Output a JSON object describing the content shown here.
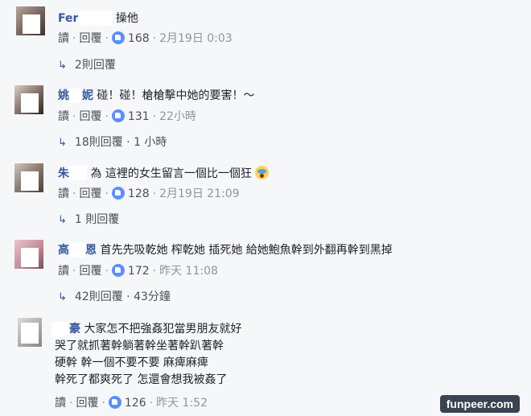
{
  "labels": {
    "read": "讀",
    "reply": "回覆"
  },
  "comments": [
    {
      "name": "Fer",
      "text": "操他",
      "likes": "168",
      "time": "2月19日 0:03",
      "replies": "2則回覆"
    },
    {
      "name": "姚",
      "name2": "妮",
      "text": "碰！碰！槍槍擊中她的要害！～",
      "likes": "131",
      "time": "22小時",
      "replies": "18則回覆 · 1 小時"
    },
    {
      "name": "朱",
      "text": "為 這裡的女生留言一個比一個狂",
      "emoji": "scream-emoji",
      "likes": "128",
      "time": "2月19日 21:09",
      "replies": "1 則回覆"
    },
    {
      "name": "高",
      "name2": "恩",
      "text": "首先先吸乾她 榨乾她 插死她 給她鮑魚幹到外翻再幹到黑掉",
      "likes": "172",
      "time": "昨天 11:08",
      "replies": "42則回覆 · 43分鐘"
    },
    {
      "name": "豪",
      "lines": [
        "大家怎不把強姦犯當男朋友就好",
        "哭了就抓著幹躺著幹坐著幹趴著幹",
        "硬幹 幹一個不要不要 麻痺麻痺",
        "幹死了都爽死了 怎還會想我被姦了"
      ],
      "likes": "126",
      "time": "昨天 1:52"
    }
  ],
  "watermark": "funpeer.com",
  "colors": {
    "name": "#365899",
    "meta": "#90949c",
    "like": "#5890ff"
  }
}
